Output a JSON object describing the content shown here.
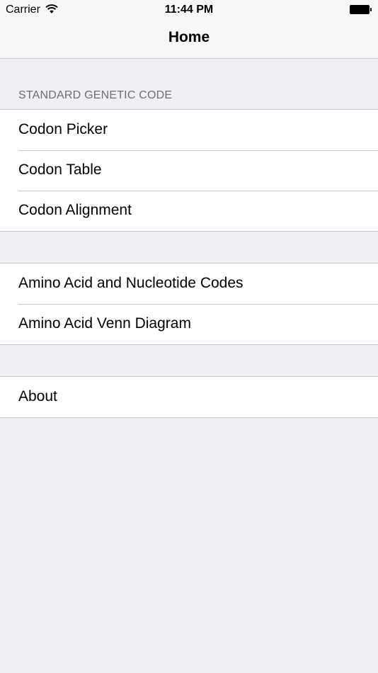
{
  "status_bar": {
    "carrier": "Carrier",
    "time": "11:44 PM",
    "wifi_icon": "wifi-icon",
    "battery_icon": "battery-icon"
  },
  "nav": {
    "title": "Home"
  },
  "sections": [
    {
      "header": "STANDARD GENETIC CODE",
      "items": [
        "Codon Picker",
        "Codon Table",
        "Codon Alignment"
      ]
    },
    {
      "header": "",
      "items": [
        "Amino Acid and Nucleotide Codes",
        "Amino Acid Venn Diagram"
      ]
    },
    {
      "header": "",
      "items": [
        "About"
      ]
    }
  ],
  "colors": {
    "background": "#efeff4",
    "separator": "#c8c7cc",
    "section_header_text": "#6d6d72"
  }
}
